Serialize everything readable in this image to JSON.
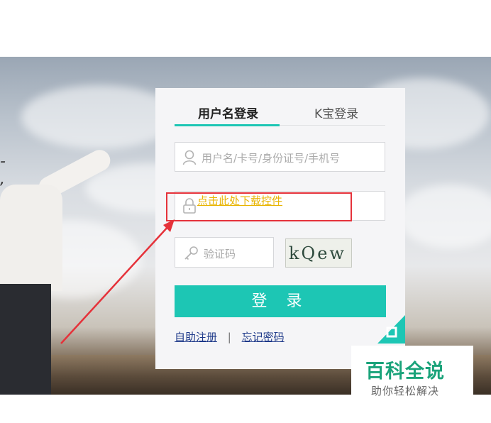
{
  "tabs": {
    "username_login": "用户名登录",
    "kbao_login": "K宝登录"
  },
  "fields": {
    "username_placeholder": "用户名/卡号/身份证号/手机号",
    "captcha_placeholder": "验证码"
  },
  "download_control_link": "点击此处下载控件",
  "captcha_text": "kQew",
  "login_button": "登 录",
  "links": {
    "register": "自助注册",
    "separator": "|",
    "forgot_password": "忘记密码"
  },
  "watermark": {
    "logo": "百科全说",
    "slogan": "助你轻松解决"
  },
  "colors": {
    "accent": "#1dc6b4",
    "annotation": "#e5323a",
    "link_warning": "#e8b400",
    "watermark_green": "#1aa37a"
  },
  "icons": [
    "user-icon",
    "lock-icon",
    "key-icon"
  ]
}
